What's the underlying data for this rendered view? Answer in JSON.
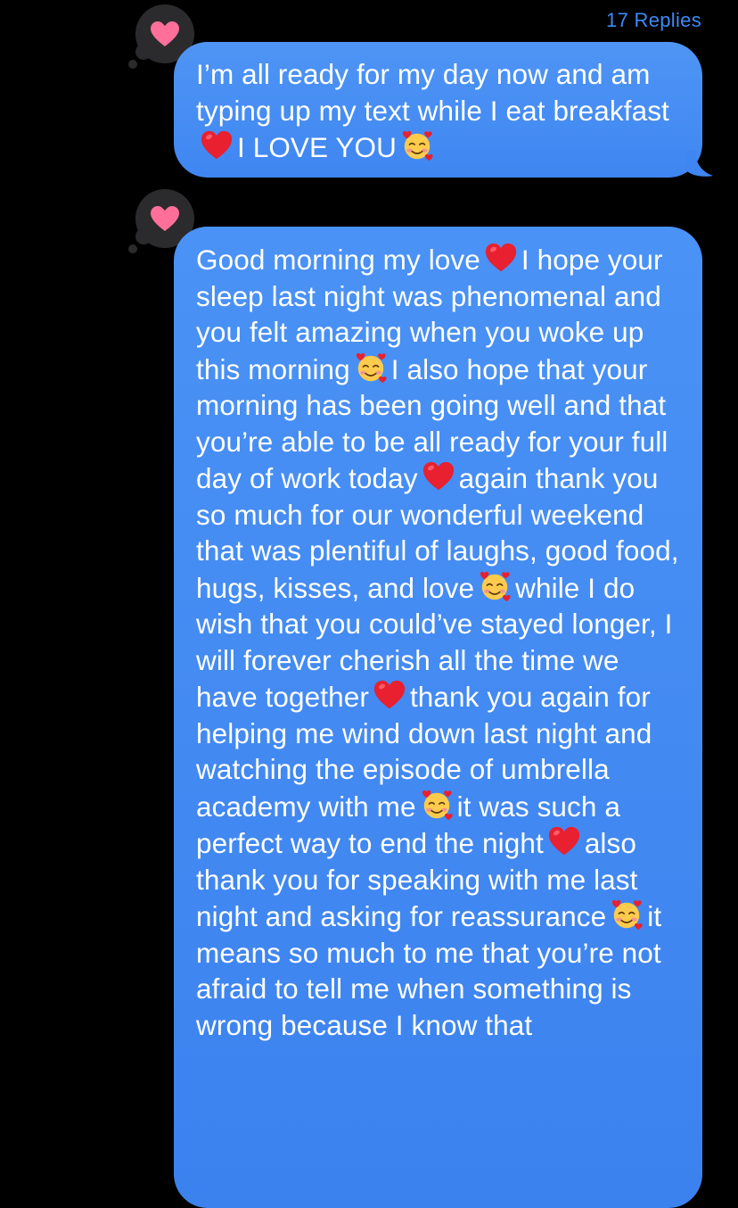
{
  "thread": {
    "replies_label": "17 Replies"
  },
  "messages": [
    {
      "id": "m1",
      "reaction_icon": "heart-reaction-icon",
      "segments": [
        {
          "t": "I’m all ready for my day now and am typing up my text while I eat breakfast"
        },
        {
          "e": "red-heart-emoji"
        },
        {
          "t": "I LOVE YOU"
        },
        {
          "e": "smiling-face-with-hearts-emoji"
        }
      ]
    },
    {
      "id": "m2",
      "reaction_icon": "heart-reaction-icon",
      "segments": [
        {
          "t": "Good morning my love"
        },
        {
          "e": "red-heart-emoji"
        },
        {
          "t": "I hope your sleep last night was phenomenal and you felt amazing when you woke up this morning"
        },
        {
          "e": "smiling-face-with-hearts-emoji"
        },
        {
          "t": "I also hope that your morning has been going well and that you’re able to be all ready for your full day of work today"
        },
        {
          "e": "red-heart-emoji"
        },
        {
          "t": "again thank you so much for our wonderful weekend that was plentiful of laughs, good food, hugs, kisses, and love"
        },
        {
          "e": "smiling-face-with-hearts-emoji"
        },
        {
          "t": "while I do wish that you could’ve stayed longer, I will forever cherish all the time we have together"
        },
        {
          "e": "red-heart-emoji"
        },
        {
          "t": "thank you again for helping me wind down last night and watching the episode of umbrella academy with me"
        },
        {
          "e": "smiling-face-with-hearts-emoji"
        },
        {
          "t": "it was such a perfect way to end the night"
        },
        {
          "e": "red-heart-emoji"
        },
        {
          "t": "also thank you for speaking with me last night and asking for reassurance"
        },
        {
          "e": "smiling-face-with-hearts-emoji"
        },
        {
          "t": "it means so much to me that you’re not afraid to tell me when something is wrong because I know that"
        }
      ]
    }
  ],
  "colors": {
    "background": "#000000",
    "bubble_blue": "#4a92f5",
    "replies_blue": "#3b8af5",
    "reaction_bubble": "#2b2b2d",
    "reaction_heart": "#ff6f9a"
  }
}
